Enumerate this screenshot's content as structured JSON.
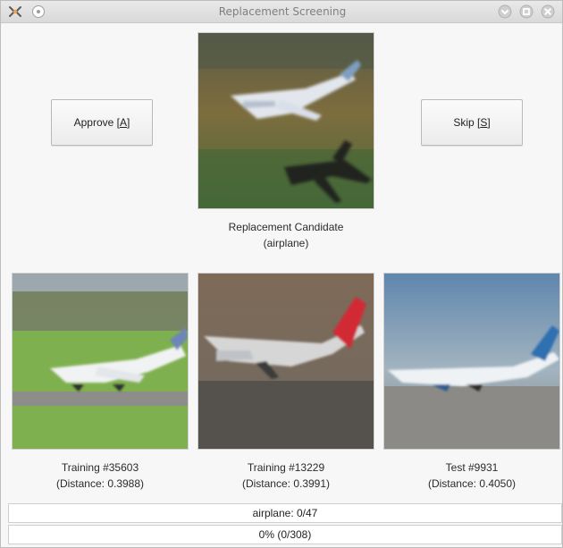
{
  "window": {
    "title": "Replacement Screening"
  },
  "actions": {
    "approve": {
      "label_prefix": "Approve [",
      "label_key": "A",
      "label_suffix": "]"
    },
    "skip": {
      "label_prefix": "Skip [",
      "label_key": "S",
      "label_suffix": "]"
    }
  },
  "candidate": {
    "title": "Replacement Candidate",
    "class_label": "(airplane)"
  },
  "neighbors": [
    {
      "title": "Training #35603",
      "distance_text": "(Distance: 0.3988)"
    },
    {
      "title": "Training #13229",
      "distance_text": "(Distance: 0.3991)"
    },
    {
      "title": "Test #9931",
      "distance_text": "(Distance: 0.4050)"
    }
  ],
  "status": {
    "class_count": "airplane: 0/47",
    "overall": "0% (0/308)"
  },
  "colors": {
    "titlebar_text": "#7f7f7f",
    "window_bg": "#f7f7f7",
    "button_border": "#b9b9b9"
  },
  "icons": {
    "app": "app-icon",
    "sticky": "sticky-pin-icon",
    "minimize": "minimize-icon",
    "maximize": "maximize-icon",
    "close": "close-icon"
  }
}
